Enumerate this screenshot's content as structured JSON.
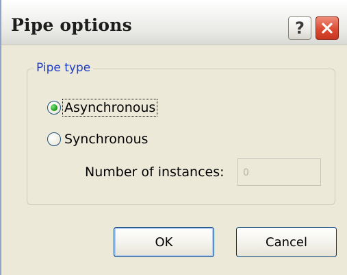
{
  "window": {
    "title": "Pipe options",
    "help_symbol": "?"
  },
  "group": {
    "label": "Pipe type"
  },
  "options": {
    "asynchronous": {
      "label": "Asynchronous",
      "selected": true
    },
    "synchronous": {
      "label": "Synchronous",
      "selected": false
    }
  },
  "instances": {
    "label": "Number of instances:",
    "value": "0",
    "enabled": false
  },
  "buttons": {
    "ok": "OK",
    "cancel": "Cancel"
  },
  "colors": {
    "group_label": "#1f3fcb",
    "close_button": "#dc4b33",
    "radio_selected": "#21a121"
  }
}
